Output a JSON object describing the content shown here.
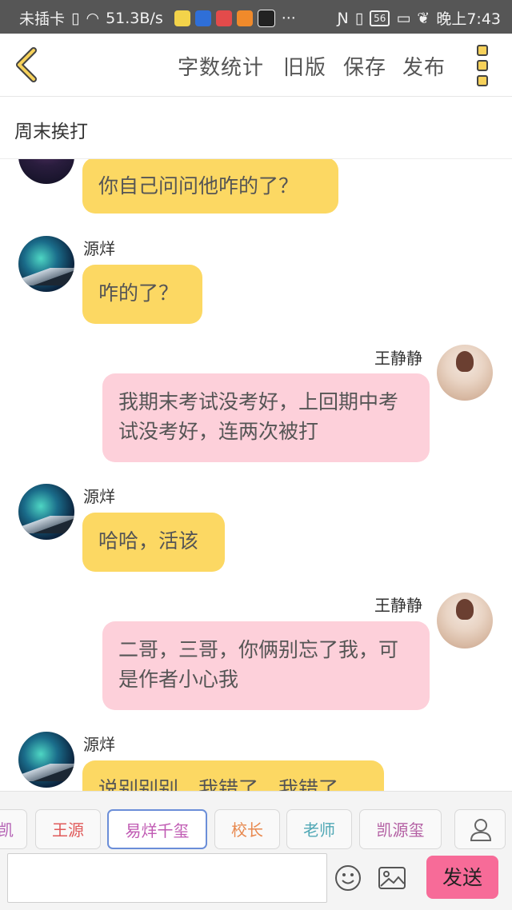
{
  "status_bar": {
    "carrier": "未插卡",
    "speed": "51.3B/s",
    "more": "···",
    "signal": "56",
    "time": "晚上7:43"
  },
  "toolbar": {
    "word_count": "字数统计",
    "old_version": "旧版",
    "save": "保存",
    "publish": "发布"
  },
  "title": "周末挨打",
  "messages": [
    {
      "side": "left",
      "name": "",
      "text": "你自己问问他咋的了？"
    },
    {
      "side": "left",
      "name": "源烊",
      "text": "咋的了？"
    },
    {
      "side": "right",
      "name": "王静静",
      "text": "我期末考试没考好，上回期中考试没考好，连两次被打"
    },
    {
      "side": "left",
      "name": "源烊",
      "text": "哈哈，活该"
    },
    {
      "side": "right",
      "name": "王静静",
      "text": "二哥，三哥，你俩别忘了我，可是作者小心我"
    },
    {
      "side": "left",
      "name": "源烊",
      "text": "说别别别，我错了，我错了"
    }
  ],
  "characters": [
    {
      "label": "凯",
      "color": "#b35fb3"
    },
    {
      "label": "王源",
      "color": "#e05a5a"
    },
    {
      "label": "易烊千玺",
      "color": "#c05ab3"
    },
    {
      "label": "校长",
      "color": "#e8894f"
    },
    {
      "label": "老师",
      "color": "#4fa7b5"
    },
    {
      "label": "凯源玺",
      "color": "#b35fa3"
    }
  ],
  "input": {
    "placeholder": "",
    "send": "发送"
  },
  "colors": {
    "accent_yellow": "#fcd863",
    "accent_pink": "#fdd0da",
    "send_button": "#f76b98"
  }
}
